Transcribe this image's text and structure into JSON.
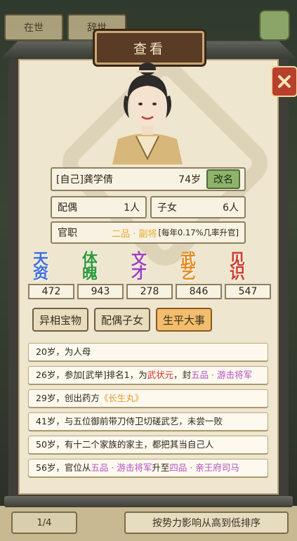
{
  "background": {
    "tabs": [
      "在世",
      "辞世"
    ],
    "pager": "1/4",
    "sort_label": "按势力影响从高到低排序"
  },
  "dialog": {
    "title": "查看",
    "name": "[自己]龚学倩",
    "age": "74岁",
    "rename_label": "改名",
    "spouse_label": "配偶",
    "spouse_count": "1人",
    "children_label": "子女",
    "children_count": "6人",
    "office_label": "官职",
    "office_rank": "二品 · 副将",
    "office_rate": "[每年0.17%几率升官]"
  },
  "stats": [
    {
      "label": "天资",
      "value": "472",
      "color": "#3f6fe0"
    },
    {
      "label": "体魄",
      "value": "943",
      "color": "#2f9a3b"
    },
    {
      "label": "文才",
      "value": "278",
      "color": "#9d3fc0"
    },
    {
      "label": "武艺",
      "value": "846",
      "color": "#e48a20"
    },
    {
      "label": "见识",
      "value": "547",
      "color": "#cf3a2c"
    }
  ],
  "tabs": [
    "异相宝物",
    "配偶子女",
    "生平大事"
  ],
  "active_tab": "生平大事",
  "events": [
    {
      "parts": [
        {
          "t": "20岁，为人母"
        }
      ]
    },
    {
      "parts": [
        {
          "t": "26岁，参加[武举]排名1，为"
        },
        {
          "t": "武状元",
          "c": "red"
        },
        {
          "t": "，封"
        },
        {
          "t": "五品 · 游击将军",
          "c": "purple"
        }
      ]
    },
    {
      "parts": [
        {
          "t": "29岁，创出药方"
        },
        {
          "t": "《长生丸》",
          "c": "orange"
        }
      ]
    },
    {
      "parts": [
        {
          "t": "41岁，与五位御前带刀侍卫切磋武艺，未尝一败"
        }
      ]
    },
    {
      "parts": [
        {
          "t": "50岁，有十二个家族的家主，都把其当自己人"
        }
      ]
    },
    {
      "parts": [
        {
          "t": "56岁，官位从"
        },
        {
          "t": "五品 · 游击将军",
          "c": "purple"
        },
        {
          "t": "升至"
        },
        {
          "t": "四品 · 亲王府司马",
          "c": "purple"
        }
      ]
    }
  ]
}
